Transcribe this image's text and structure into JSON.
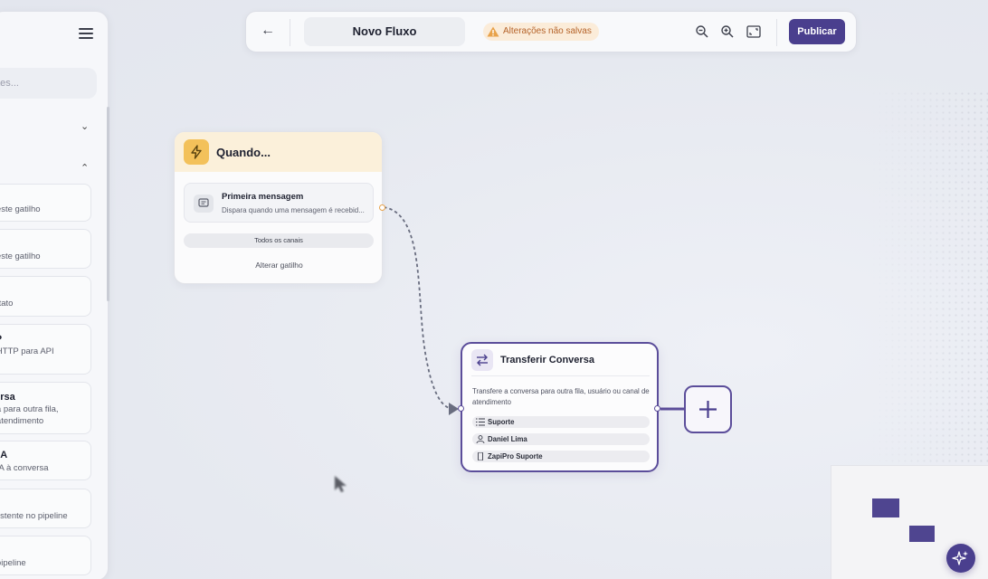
{
  "sidebar": {
    "search_placeholder": "ntes...",
    "items": [
      {
        "title": "",
        "desc": "a este gatilho"
      },
      {
        "title": "sa",
        "desc": "a este gatilho"
      },
      {
        "title": "",
        "desc": "ontato"
      },
      {
        "title": "TP",
        "desc": "o HTTP para API"
      },
      {
        "title": "versa",
        "desc": "rsa para outra fila,",
        "desc2": "e atendimento"
      },
      {
        "title": "e IA",
        "desc": "e IA à conversa"
      },
      {
        "title": "o",
        "desc": "existente no pipeline"
      },
      {
        "title": "",
        "desc": "o pipeline"
      }
    ]
  },
  "topbar": {
    "title": "Novo Fluxo",
    "warning": "Alterações não salvas",
    "publish": "Publicar"
  },
  "trigger_node": {
    "title": "Quando...",
    "message_title": "Primeira mensagem",
    "message_desc": "Dispara quando uma mensagem é recebid...",
    "channels": "Todos os canais",
    "change": "Alterar gatilho"
  },
  "transfer_node": {
    "title": "Transferir Conversa",
    "desc": "Transfere a conversa para outra fila, usuário ou canal de atendimento",
    "rows": [
      "Suporte",
      "Daniel Lima",
      "ZapiPro Suporte"
    ]
  },
  "colors": {
    "accent": "#4a3f8e",
    "warning_bg": "#fbecd9",
    "trigger_header": "#fbf0da"
  }
}
